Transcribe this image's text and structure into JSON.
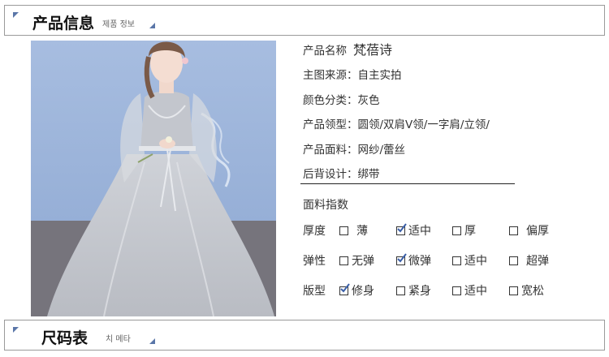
{
  "header_top": {
    "title": "产品信息",
    "subtitle": "제품 정보"
  },
  "header_bottom": {
    "title": "尺码表",
    "subtitle": "치 메타"
  },
  "product": {
    "name_label": "产品名称",
    "name_value": "梵蓓诗",
    "source_label": "主图来源：",
    "source_value": "自主实拍",
    "color_label": "颜色分类：",
    "color_value": "灰色",
    "collar_label": "产品领型：",
    "collar_value": "圆领/双肩V领/一字肩/立领/",
    "fabric_label": "产品面料：",
    "fabric_value": "网纱/蕾丝",
    "back_label": "后背设计：",
    "back_value": "绑带"
  },
  "fabric_index": {
    "title": "面料指数",
    "rows": [
      {
        "label": "厚度",
        "options": [
          {
            "text": "薄",
            "checked": false
          },
          {
            "text": "适中",
            "checked": true
          },
          {
            "text": "厚",
            "checked": false
          },
          {
            "text": "偏厚",
            "checked": false
          }
        ]
      },
      {
        "label": "弹性",
        "options": [
          {
            "text": "无弹",
            "checked": false
          },
          {
            "text": "微弹",
            "checked": true
          },
          {
            "text": "适中",
            "checked": false
          },
          {
            "text": "超弹",
            "checked": false
          }
        ]
      },
      {
        "label": "版型",
        "options": [
          {
            "text": "修身",
            "checked": true
          },
          {
            "text": "紧身",
            "checked": false
          },
          {
            "text": "适中",
            "checked": false
          },
          {
            "text": "宽松",
            "checked": false
          }
        ]
      }
    ]
  },
  "colors": {
    "accent": "#5a76a8",
    "check": "#3a5fa8",
    "photo_bg": "#9bb3d6",
    "dress": "#c9ccd1"
  }
}
